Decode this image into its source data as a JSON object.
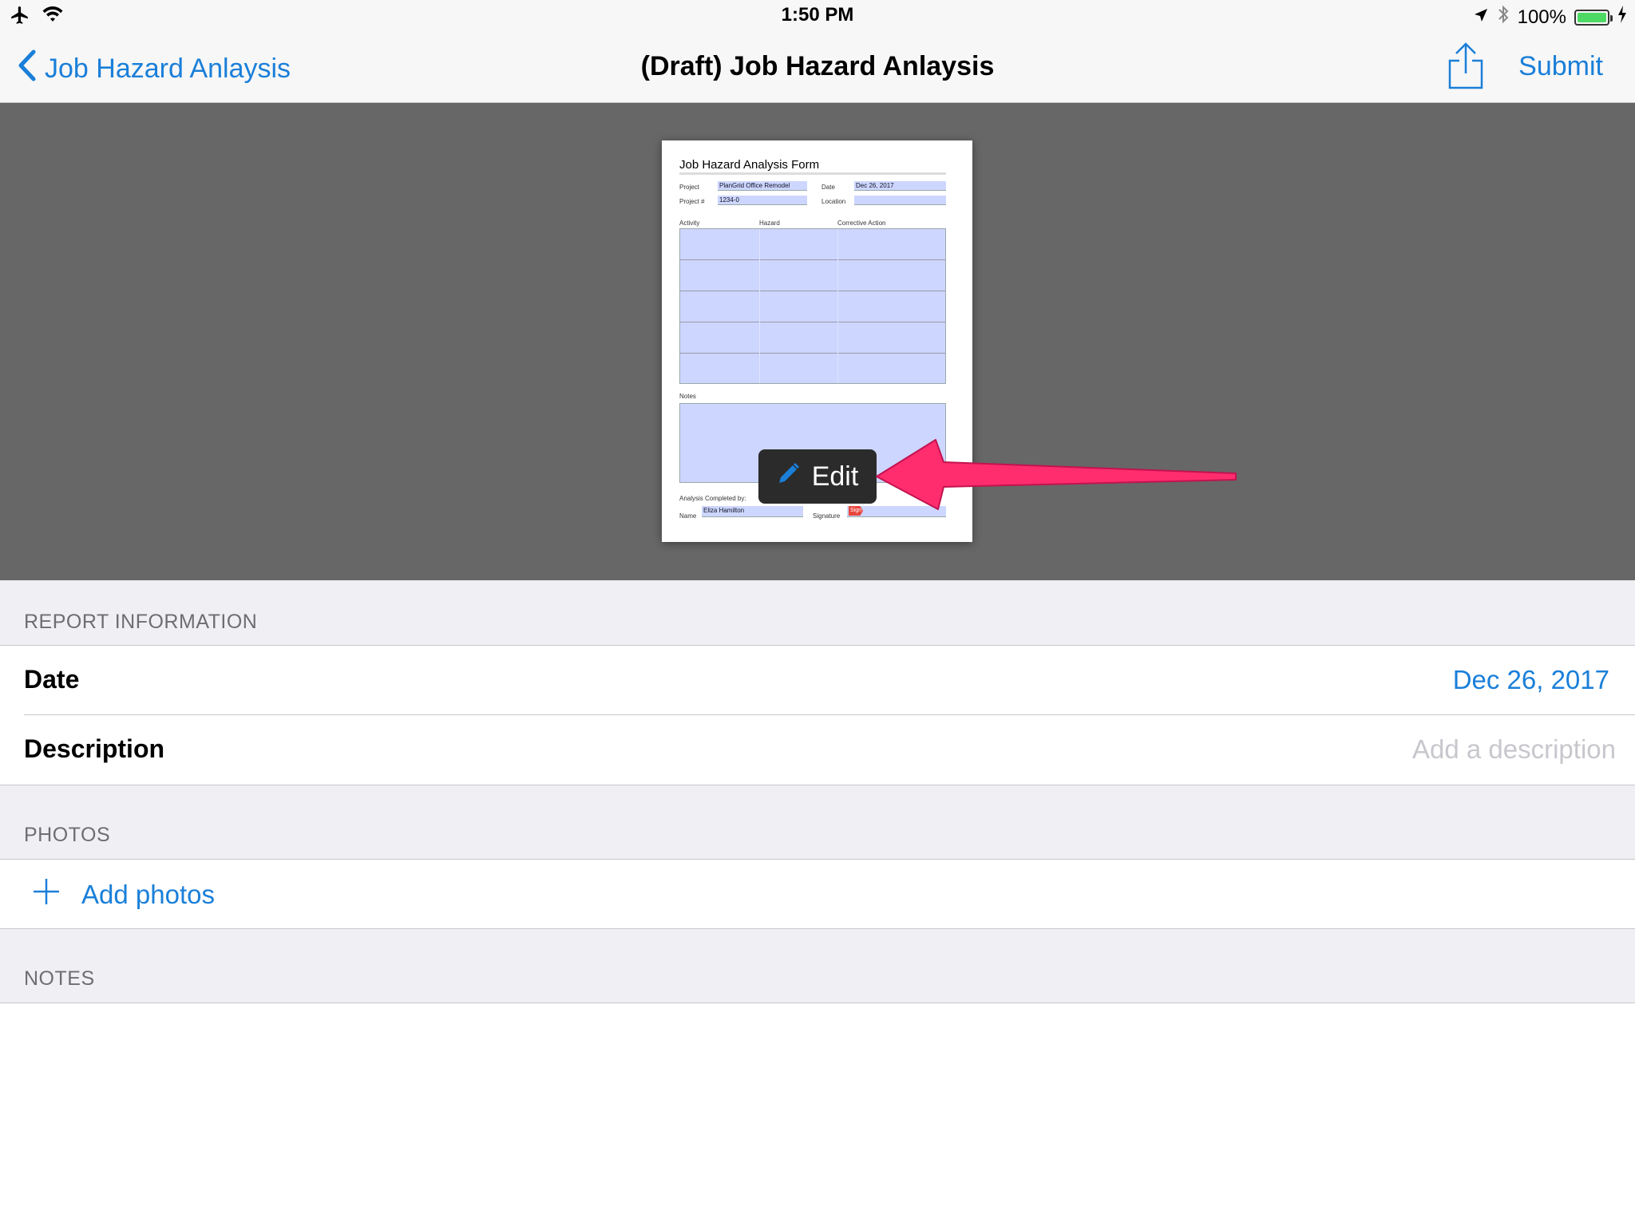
{
  "status_bar": {
    "time": "1:50 PM",
    "battery": "100%",
    "icons": [
      "airplane-icon",
      "wifi-icon",
      "location-icon",
      "bluetooth-icon",
      "battery-icon",
      "charging-icon"
    ]
  },
  "nav": {
    "back_label": "Job Hazard Anlaysis",
    "title": "(Draft) Job Hazard Anlaysis",
    "submit_label": "Submit"
  },
  "preview": {
    "form_title": "Job Hazard Analysis Form",
    "labels": {
      "project": "Project",
      "date": "Date",
      "project_num": "Project #",
      "location": "Location",
      "activity": "Activity",
      "hazard": "Hazard",
      "corrective_action": "Corrective Action",
      "notes": "Notes",
      "completed_by": "Analysis Completed by:",
      "name": "Name",
      "signature": "Signature"
    },
    "values": {
      "project": "PlanGrid Office Remodel",
      "date": "Dec 26, 2017",
      "project_num": "1234-0",
      "name": "Eliza Hamilton",
      "sign_tag": "Sign"
    },
    "edit_label": "Edit"
  },
  "report_info": {
    "header": "REPORT INFORMATION",
    "date_label": "Date",
    "date_value": "Dec 26, 2017",
    "description_label": "Description",
    "description_placeholder": "Add a description"
  },
  "photos": {
    "header": "PHOTOS",
    "add_label": "Add photos"
  },
  "notes": {
    "header": "NOTES"
  },
  "colors": {
    "accent": "#1a7fd9",
    "preview_bg": "#676767",
    "annotation_arrow": "#ff2d6e",
    "section_bg": "#efeff4"
  }
}
